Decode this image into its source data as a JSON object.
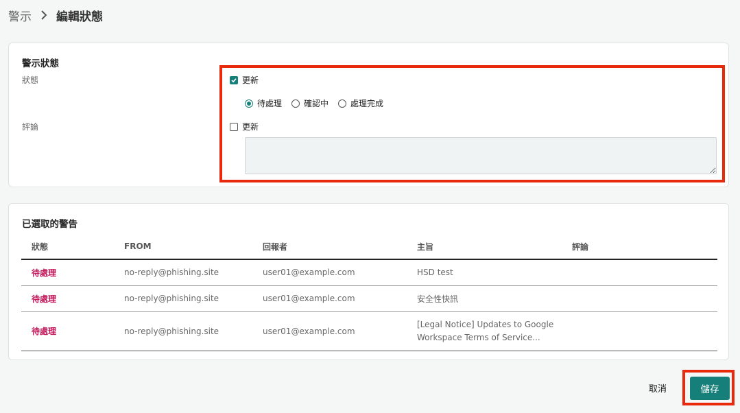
{
  "breadcrumb": {
    "parent": "警示",
    "current": "編輯狀態"
  },
  "status_card": {
    "title": "警示狀態",
    "status_label": "狀態",
    "comment_label": "評論",
    "status_update_label": "更新",
    "status_update_checked": true,
    "status_options": [
      {
        "label": "待處理",
        "selected": true
      },
      {
        "label": "確認中",
        "selected": false
      },
      {
        "label": "處理完成",
        "selected": false
      }
    ],
    "comment_update_label": "更新",
    "comment_update_checked": false,
    "comment_value": ""
  },
  "selected_card": {
    "title": "已選取的警告",
    "columns": [
      "狀態",
      "FROM",
      "回報者",
      "主旨",
      "評論"
    ],
    "rows": [
      {
        "status": "待處理",
        "from": "no-reply@phishing.site",
        "reporter": "user01@example.com",
        "subject": "HSD test",
        "comment": ""
      },
      {
        "status": "待處理",
        "from": "no-reply@phishing.site",
        "reporter": "user01@example.com",
        "subject": "安全性快訊",
        "comment": ""
      },
      {
        "status": "待處理",
        "from": "no-reply@phishing.site",
        "reporter": "user01@example.com",
        "subject_line1": "[Legal Notice] Updates to Google",
        "subject_line2": "Workspace Terms of Service...",
        "comment": ""
      }
    ]
  },
  "actions": {
    "cancel_label": "取消",
    "save_label": "儲存"
  },
  "colors": {
    "accent": "#167f7a",
    "pending": "#c2185b",
    "highlight": "#e8290b"
  }
}
